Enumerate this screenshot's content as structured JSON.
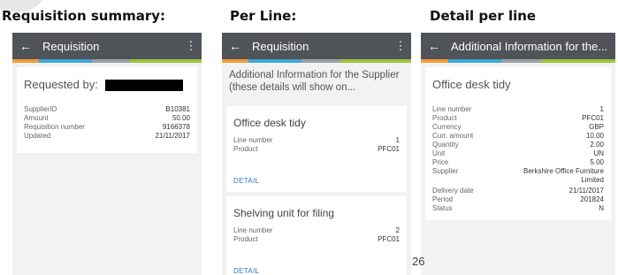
{
  "sections": {
    "s1_title": "Requisition summary:",
    "s2_title": "Per Line:",
    "s3_title": "Detail per line"
  },
  "panel1": {
    "appbar_title": "Requisition",
    "requested_by_label": "Requested by:",
    "fields": [
      {
        "label": "SupplierID",
        "value": "B10381"
      },
      {
        "label": "Amount",
        "value": "50.00"
      },
      {
        "label": "Requisition number",
        "value": "9166378"
      },
      {
        "label": "Updated",
        "value": "21/11/2017"
      }
    ]
  },
  "panel2": {
    "appbar_title": "Requisition",
    "info_text": "Additional Information for the Supplier (these details will show on...",
    "lines": [
      {
        "title": "Office desk tidy",
        "fields": [
          {
            "label": "Line number",
            "value": "1"
          },
          {
            "label": "Product",
            "value": "PFC01"
          }
        ],
        "detail_label": "DETAIL"
      },
      {
        "title": "Shelving unit for filing",
        "fields": [
          {
            "label": "Line number",
            "value": "2"
          },
          {
            "label": "Product",
            "value": "PFC01"
          }
        ],
        "detail_label": "DETAIL"
      }
    ]
  },
  "panel3": {
    "appbar_title": "Additional Information for the...",
    "item_title": "Office desk tidy",
    "fields": [
      {
        "label": "Line number",
        "value": "1"
      },
      {
        "label": "Product",
        "value": "PFC01"
      },
      {
        "label": "Currency",
        "value": "GBP"
      },
      {
        "label": "Curr. amount",
        "value": "10.00"
      },
      {
        "label": "Quantity",
        "value": "2.00"
      },
      {
        "label": "Unit",
        "value": "UN"
      },
      {
        "label": "Price",
        "value": "5.00"
      },
      {
        "label": "Supplier",
        "value": "Berkshire Office Furniture Limited"
      },
      {
        "label": "Delivery date",
        "value": "21/11/2017"
      },
      {
        "label": "Period",
        "value": "201824"
      },
      {
        "label": "Status",
        "value": "N"
      }
    ]
  },
  "page_number": "26",
  "icons": {
    "back": "arrow-left-icon",
    "menu": "more-vert-icon"
  },
  "colors": {
    "appbar": "#505357",
    "stripe_orange": "#f39c34",
    "stripe_blue": "#3aa8d8",
    "stripe_gray": "#9aa0a6",
    "stripe_green": "#9cc23a",
    "link": "#2a7abf"
  }
}
